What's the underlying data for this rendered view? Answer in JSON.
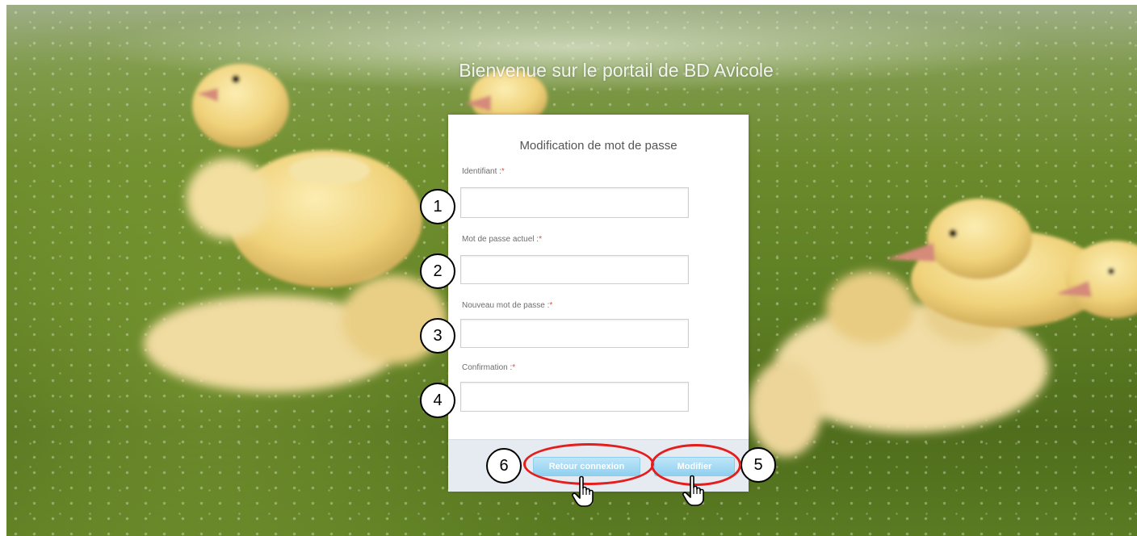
{
  "page": {
    "portal_title": "Bienvenue sur le portail de BD Avicole"
  },
  "form": {
    "title": "Modification de mot de passe",
    "required_mark": "*",
    "fields": [
      {
        "label": "Identifiant :",
        "value": ""
      },
      {
        "label": "Mot de passe actuel :",
        "value": ""
      },
      {
        "label": "Nouveau mot de passe :",
        "value": ""
      },
      {
        "label": "Confirmation :",
        "value": ""
      }
    ],
    "buttons": {
      "back_label": "Retour connexion",
      "submit_label": "Modifier"
    }
  },
  "callouts": [
    "1",
    "2",
    "3",
    "4",
    "5",
    "6"
  ],
  "colors": {
    "button_fill": "#8fd0ef",
    "button_text": "#ffffff",
    "footer_bg": "#e6ebf1",
    "callout_ring": "#e41d1d",
    "required_star": "#d9534f"
  },
  "icons": {
    "cursor": "hand-pointer-icon"
  }
}
